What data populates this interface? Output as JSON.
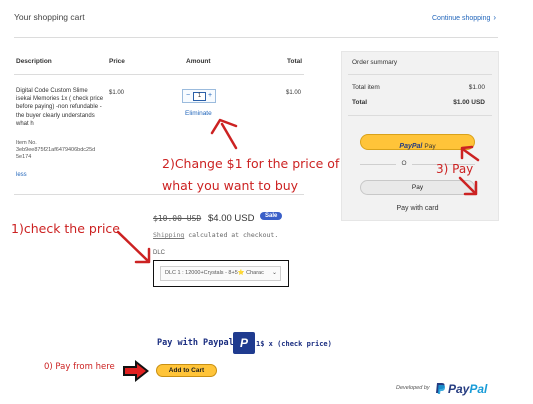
{
  "cart": {
    "title": "Your shopping cart",
    "continue_label": "Continue shopping",
    "continue_chevron": "›",
    "columns": [
      "Description",
      "Price",
      "Amount",
      "Total"
    ],
    "item": {
      "description": "Digital Code Custom Slime isekai Memories 1x ( check price before paying) -non refundable -the buyer clearly understands what h",
      "item_no_label": "Item No.",
      "item_no": "3eb9ee875f21af6479406bdc25d5e174",
      "less_label": "less",
      "price": "$1.00",
      "quantity": "1",
      "minus": "−",
      "plus": "+",
      "total": "$1.00",
      "eliminate_label": "Eliminate"
    }
  },
  "summary": {
    "title": "Order summary",
    "rows": [
      {
        "label": "Total item",
        "value": "$1.00"
      },
      {
        "label": "Total",
        "value": "$1.00 USD"
      }
    ],
    "paypal_brand": "PayPal",
    "paypal_pay": "Pay",
    "or_label": "O",
    "pay_label": "Pay",
    "pay_with_card": "Pay with card"
  },
  "product": {
    "old_price": "$10.00 USD",
    "new_price": "$4.00 USD",
    "sale_badge": "Sale",
    "shipping_link": "Shipping",
    "shipping_rest": " calculated at checkout.",
    "dlc_label": "DLC",
    "dlc_selected": "DLC 1 : 12000+Crystals - 8+5⭐ Charac",
    "dlc_caret": "⌄"
  },
  "annotations": {
    "change_line1": "2)Change $1 for the price of",
    "change_line2": "what you want to buy",
    "pay3": "3) Pay",
    "check_price": "1)check the price",
    "pay_from_here": "0) Pay from here"
  },
  "paypal_row": {
    "label": "Pay with Paypal :",
    "logo_letter": "P",
    "price_text": "1$ x (check price)",
    "add_to_cart": "Add to Cart"
  },
  "footer": {
    "developed_by": "Developed by",
    "brand_pay": "Pay",
    "brand_pal": "Pal"
  },
  "colors": {
    "annotation_red": "#cc2222",
    "paypal_yellow": "#ffc439",
    "paypal_blue": "#253b80",
    "link_blue": "#2266bb"
  }
}
